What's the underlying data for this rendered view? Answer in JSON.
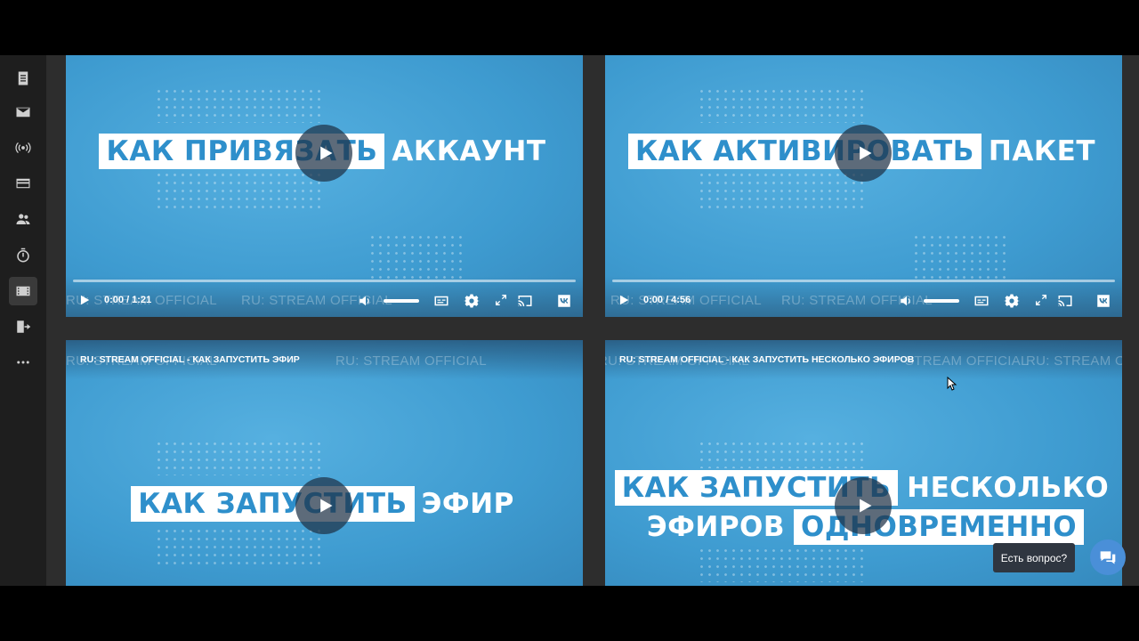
{
  "sidebar": {
    "items": [
      {
        "icon": "document-icon"
      },
      {
        "icon": "mail-icon"
      },
      {
        "icon": "broadcast-icon"
      },
      {
        "icon": "card-icon"
      },
      {
        "icon": "users-icon"
      },
      {
        "icon": "timer-icon"
      },
      {
        "icon": "video-icon",
        "active": true
      },
      {
        "icon": "exit-icon"
      },
      {
        "icon": "more-icon"
      }
    ]
  },
  "videos": [
    {
      "title_box": "КАК ПРИВЯЗАТЬ",
      "title_text": "АККАУНТ",
      "time": "0:00 / 1:21",
      "watermark": "RU: STREAM OFFICIAL"
    },
    {
      "title_box": "КАК АКТИВИРОВАТЬ",
      "title_text": "ПАКЕТ",
      "time": "0:00 / 4:56",
      "watermark": "RU: STREAM OFFICIAL"
    },
    {
      "header": "RU: STREAM OFFICIAL - КАК ЗАПУСТИТЬ ЭФИР",
      "title_box": "КАК ЗАПУСТИТЬ",
      "title_text": "ЭФИР",
      "watermark": "RU: STREAM OFFICIAL"
    },
    {
      "header": "RU: STREAM OFFICIAL - КАК ЗАПУСТИТЬ НЕСКОЛЬКО ЭФИРОВ",
      "title_box": "КАК ЗАПУСТИТЬ",
      "title_text": "НЕСКОЛЬКО",
      "title_text2": "ЭФИРОВ",
      "title_box2": "ОДНОВРЕМЕННО",
      "watermark": "STREAM OFFICIAL"
    }
  ],
  "chat": {
    "tooltip": "Есть вопрос?"
  },
  "colors": {
    "accent": "#4aa3d4",
    "sidebar": "#1e1e1e"
  }
}
